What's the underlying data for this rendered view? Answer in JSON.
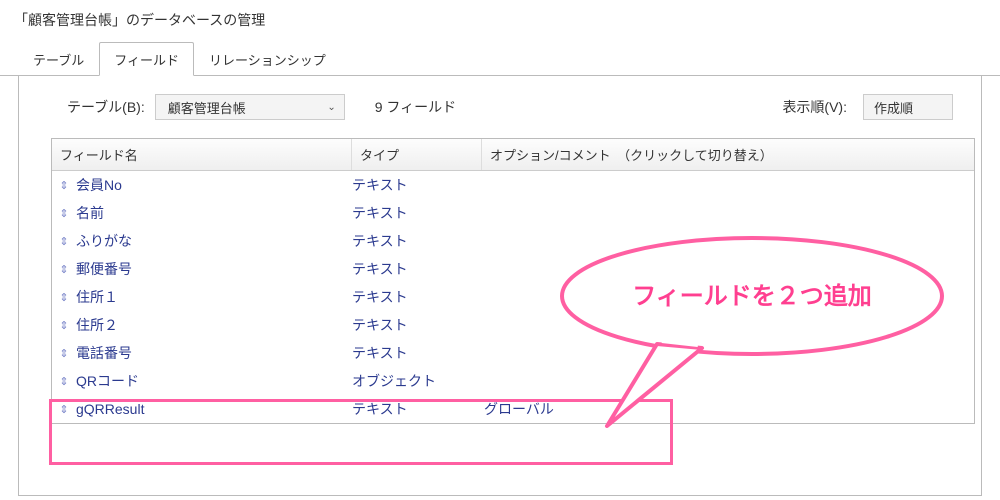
{
  "window": {
    "title": "「顧客管理台帳」のデータベースの管理"
  },
  "tabs": {
    "items": [
      {
        "label": "テーブル"
      },
      {
        "label": "フィールド"
      },
      {
        "label": "リレーションシップ"
      }
    ],
    "active_index": 1
  },
  "toolbar": {
    "table_label": "テーブル(B):",
    "table_select_value": "顧客管理台帳",
    "field_count": "9 フィールド",
    "sort_label": "表示順(V):",
    "sort_value": "作成順"
  },
  "grid": {
    "headers": {
      "name": "フィールド名",
      "type": "タイプ",
      "options": "オプション/コメント　（クリックして切り替え）"
    },
    "rows": [
      {
        "name": "会員No",
        "type": "テキスト",
        "opt": ""
      },
      {
        "name": "名前",
        "type": "テキスト",
        "opt": ""
      },
      {
        "name": "ふりがな",
        "type": "テキスト",
        "opt": ""
      },
      {
        "name": "郵便番号",
        "type": "テキスト",
        "opt": ""
      },
      {
        "name": "住所１",
        "type": "テキスト",
        "opt": ""
      },
      {
        "name": "住所２",
        "type": "テキスト",
        "opt": ""
      },
      {
        "name": "電話番号",
        "type": "テキスト",
        "opt": ""
      },
      {
        "name": "QRコード",
        "type": "オブジェクト",
        "opt": ""
      },
      {
        "name": "gQRResult",
        "type": "テキスト",
        "opt": "グローバル"
      }
    ]
  },
  "annotation": {
    "callout_text": "フィールドを２つ追加"
  }
}
